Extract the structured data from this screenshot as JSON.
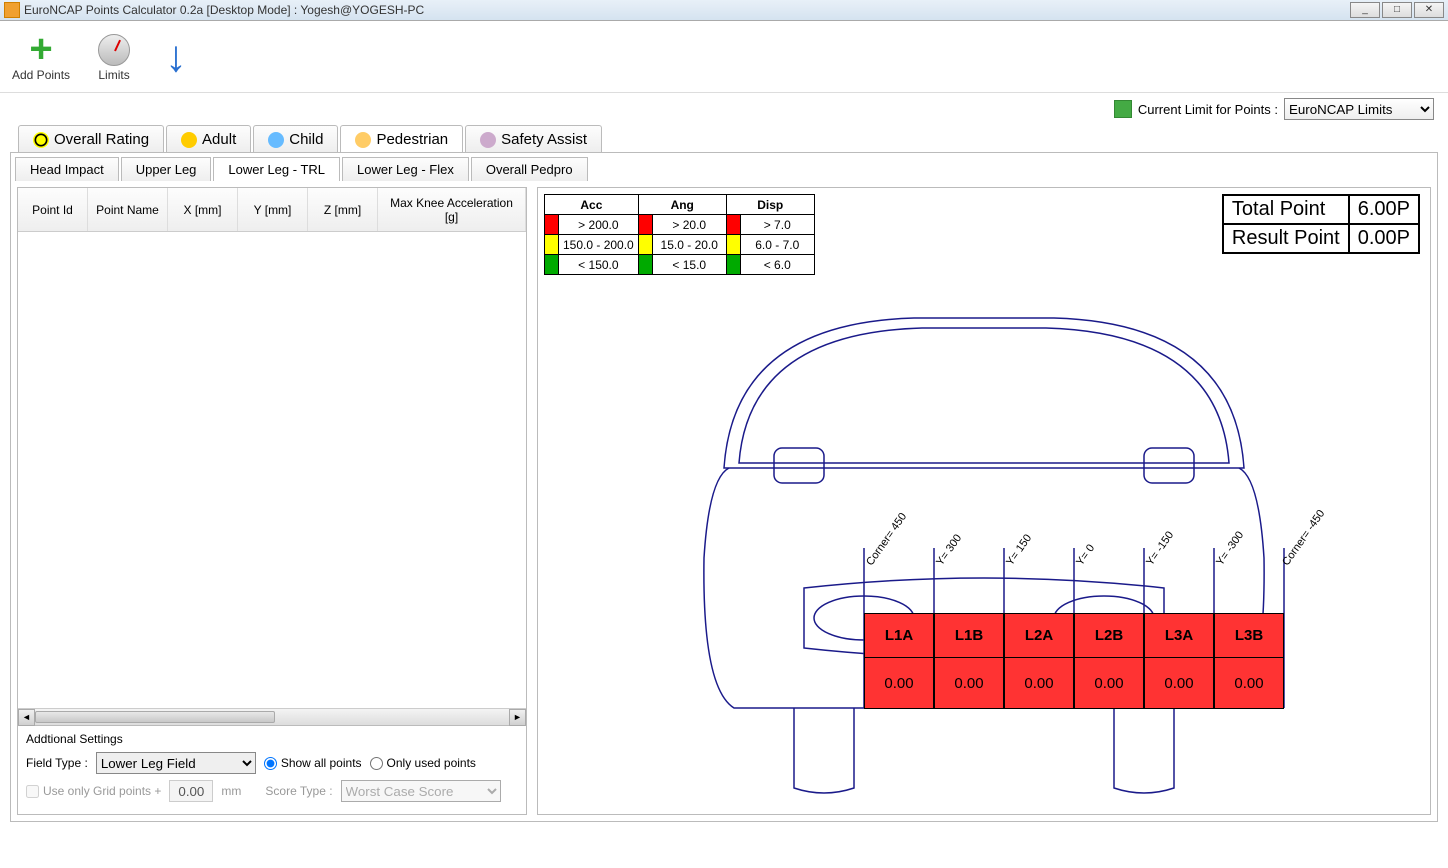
{
  "window": {
    "title": "EuroNCAP Points Calculator 0.2a [Desktop Mode] : Yogesh@YOGESH-PC"
  },
  "toolbar": {
    "add_points": "Add Points",
    "limits": "Limits"
  },
  "limits_bar": {
    "label": "Current Limit for Points :",
    "selected": "EuroNCAP Limits"
  },
  "main_tabs": {
    "overall": "Overall Rating",
    "adult": "Adult",
    "child": "Child",
    "pedestrian": "Pedestrian",
    "safety": "Safety Assist"
  },
  "sub_tabs": {
    "head": "Head Impact",
    "upper": "Upper Leg",
    "lower_trl": "Lower Leg - TRL",
    "lower_flex": "Lower Leg - Flex",
    "overall": "Overall Pedpro"
  },
  "grid_headers": {
    "id": "Point Id",
    "name": "Point Name",
    "x": "X [mm]",
    "y": "Y [mm]",
    "z": "Z [mm]",
    "max": "Max Knee Acceleration [g]"
  },
  "settings": {
    "title": "Addtional Settings",
    "field_type_label": "Field Type  :",
    "field_type_value": "Lower Leg Field",
    "show_all": "Show all points",
    "only_used": "Only used points",
    "use_grid": "Use only Grid points +",
    "mm_value": "0.00",
    "mm_unit": "mm",
    "score_type_label": "Score Type :",
    "score_type_value": "Worst Case Score"
  },
  "legend": {
    "h_acc": "Acc",
    "h_ang": "Ang",
    "h_disp": "Disp",
    "r": {
      "acc": "> 200.0",
      "ang": "> 20.0",
      "disp": "> 7.0"
    },
    "y": {
      "acc": "150.0 - 200.0",
      "ang": "15.0 - 20.0",
      "disp": "6.0 - 7.0"
    },
    "g": {
      "acc": "< 150.0",
      "ang": "< 15.0",
      "disp": "< 6.0"
    }
  },
  "results": {
    "total_label": "Total Point",
    "total_value": "6.00P",
    "result_label": "Result Point",
    "result_value": "0.00P"
  },
  "y_labels": {
    "corner_l": "Corner= 450",
    "y300": "Y= 300",
    "y150": "Y= 150",
    "y0": "Y= 0",
    "ym150": "Y= -150",
    "ym300": "Y= -300",
    "corner_r": "Corner= -450"
  },
  "bumper": [
    {
      "label": "L1A",
      "value": "0.00"
    },
    {
      "label": "L1B",
      "value": "0.00"
    },
    {
      "label": "L2A",
      "value": "0.00"
    },
    {
      "label": "L2B",
      "value": "0.00"
    },
    {
      "label": "L3A",
      "value": "0.00"
    },
    {
      "label": "L3B",
      "value": "0.00"
    }
  ]
}
